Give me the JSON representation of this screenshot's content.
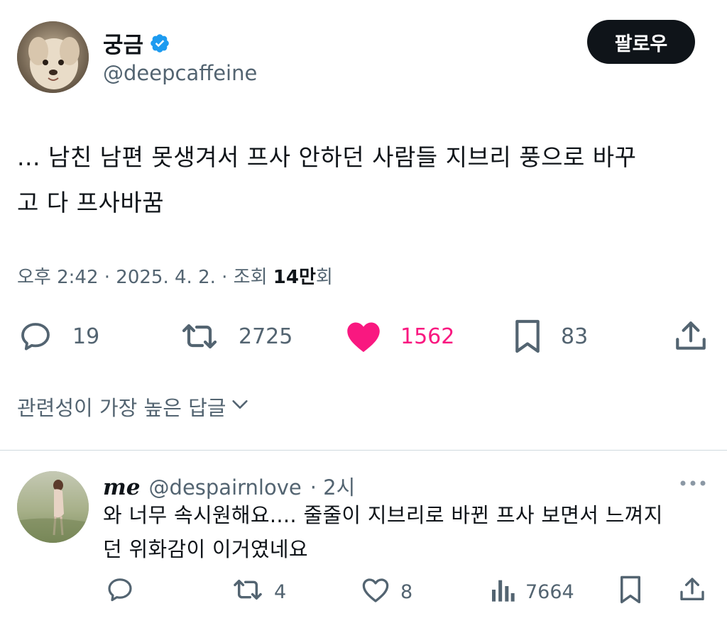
{
  "tweet": {
    "author": {
      "name": "궁금",
      "handle": "@deepcaffeine",
      "verified": true,
      "verified_color": "#1d9bf0"
    },
    "follow_label": "팔로우",
    "text_line1": "... 남친 남편 못생겨서 프사 안하던 사람들 지브리 풍으로 바꾸",
    "text_line2": "고 다 프사바꿈",
    "meta": {
      "time": "오후 2:42",
      "separator": " · ",
      "date": "2025. 4. 2.",
      "views_label": "조회",
      "views_count": "14만",
      "views_suffix": "회"
    },
    "actions": {
      "replies": "19",
      "retweets": "2725",
      "likes": "1562",
      "bookmarks": "83"
    },
    "like_color": "#f91880"
  },
  "sort": {
    "label": "관련성이 가장 높은 답글"
  },
  "reply": {
    "name": "me",
    "handle": "@despairnlove",
    "time": "· 2시",
    "text_line1": "와 너무 속시원해요.... 줄줄이 지브리로 바뀐 프사 보면서 느껴지",
    "text_line2": "던 위화감이 이거였네요",
    "actions": {
      "retweets": "4",
      "likes": "8",
      "views": "7664"
    }
  },
  "icons": {
    "verified": "verified-badge-icon",
    "reply": "reply-icon",
    "retweet": "retweet-icon",
    "like": "heart-icon",
    "bookmark": "bookmark-icon",
    "share": "share-icon",
    "chevron": "chevron-down-icon",
    "more": "more-icon",
    "analytics": "analytics-icon"
  },
  "colors": {
    "text_primary": "#0f1419",
    "text_secondary": "#536471",
    "divider": "#cfd9de"
  }
}
